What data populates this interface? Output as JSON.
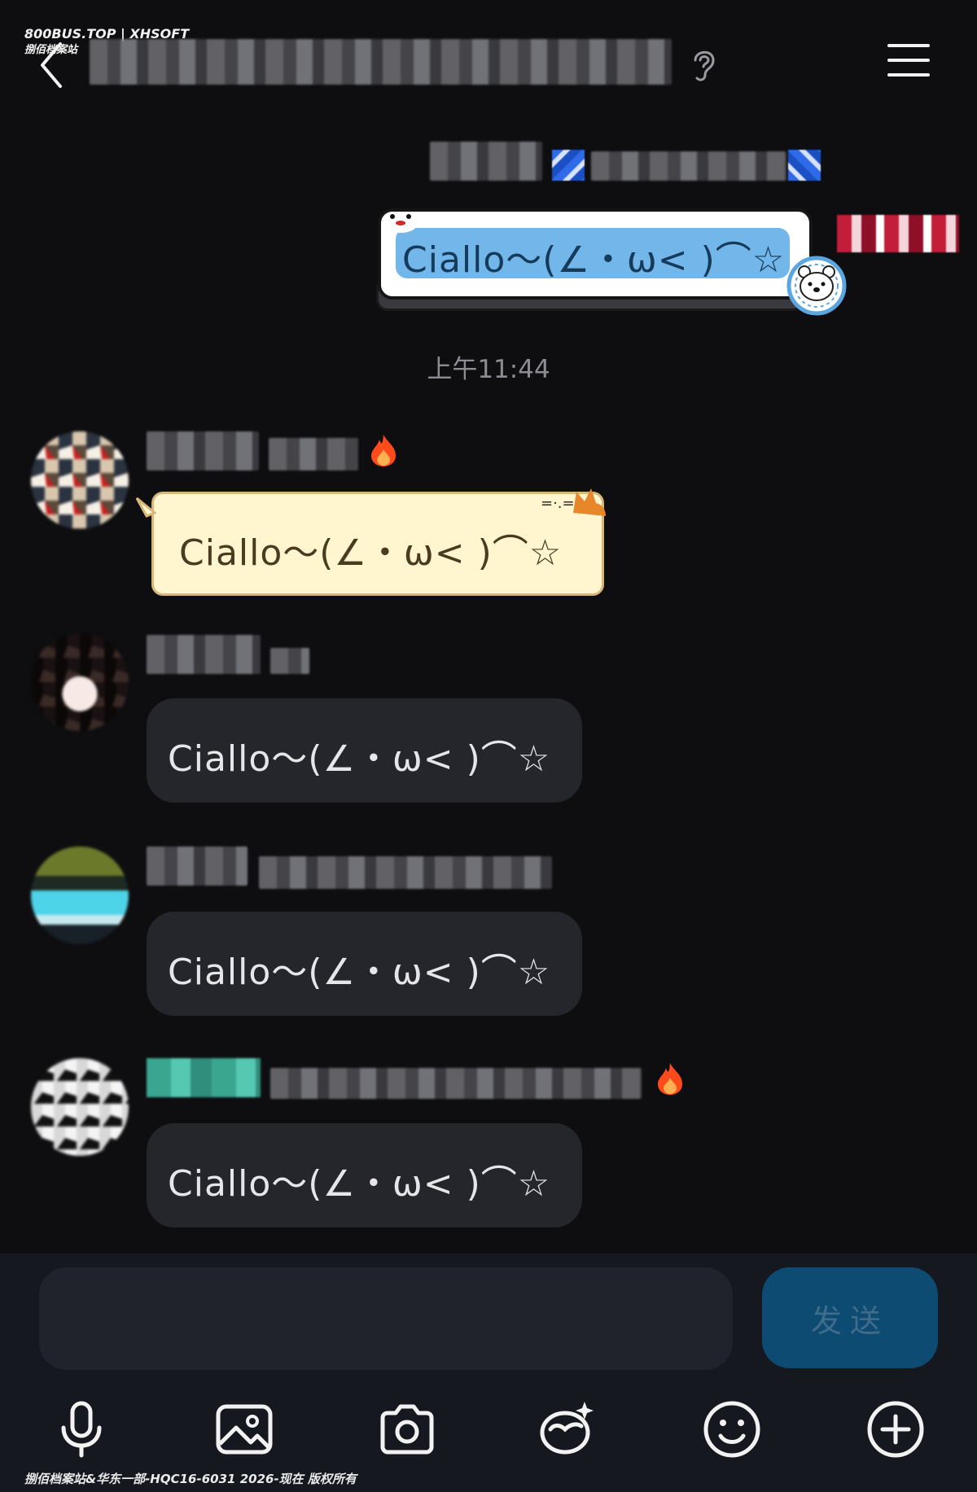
{
  "watermark": {
    "top_line1": "800BUS.TOP | XHSOFT",
    "top_line2": "捌佰档案站",
    "bottom": "捌佰档案站&华东一部-HQC16-6031 2026-现在 版权所有"
  },
  "outgoing": {
    "text": "Ciallo～(∠・ω< )⌒☆",
    "bubble_colors": {
      "frame": "#ffffff",
      "inner": "#72b6ea"
    }
  },
  "timestamp": "上午11:44",
  "messages": [
    {
      "text": "Ciallo～(∠・ω< )⌒☆",
      "style": "cat-bubble"
    },
    {
      "text": "Ciallo～(∠・ω< )⌒☆",
      "style": "default"
    },
    {
      "text": "Ciallo～(∠・ω< )⌒☆",
      "style": "default"
    },
    {
      "text": "Ciallo～(∠・ω< )⌒☆",
      "style": "default"
    }
  ],
  "composer": {
    "input_value": "",
    "send_label": "发送"
  },
  "toolbar": [
    "microphone-icon",
    "image-icon",
    "camera-icon",
    "doodle-icon",
    "emoji-icon",
    "plus-icon"
  ],
  "colors": {
    "background": "#0e0e10",
    "bubble": "#25262b",
    "send": "#0e4b72",
    "flame": "#ff4a1c"
  }
}
